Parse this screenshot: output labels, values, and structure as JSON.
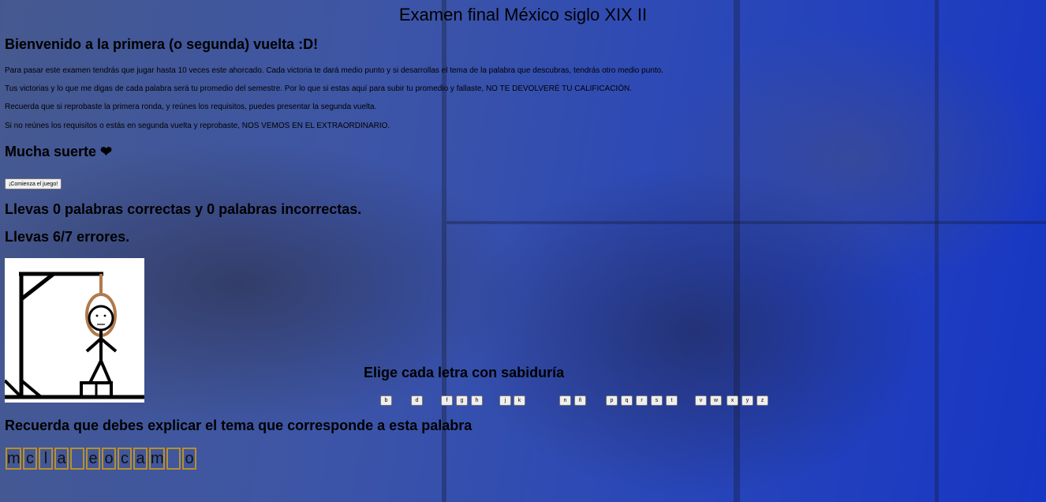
{
  "page": {
    "title": "Examen final México siglo XIX II",
    "welcome_heading": "Bienvenido a la primera (o segunda) vuelta :D!",
    "paragraphs": [
      "Para pasar este examen tendrás que jugar hasta 10 veces este ahorcado. Cada victoria te dará medio punto y si desarrollas el tema de la palabra que descubras, tendrás otro medio punto.",
      "Tus victorias y lo que me digas de cada palabra será tu promedio del semestre. Por lo que si estas aquí para subir tu promedio y fallaste, NO TE DEVOLVERÉ TU CALIFICACIÓN.",
      "Recuerda que si reprobaste la primera ronda, y reúnes los requisitos, puedes presentar la segunda vuelta.",
      "Si no reúnes los requisitos o estás en segunda vuelta y reprobaste, NOS VEMOS EN EL EXTRAORDINARIO."
    ],
    "luck_heading": "Mucha suerte ❤",
    "start_button": "¡Comienza el juego!",
    "score_text": "Llevas 0 palabras correctas y 0 palabras incorrectas.",
    "errors_text": "Llevas 6/7 errores.",
    "letters_heading": "Elige cada letra con sabiduría",
    "remember_heading": "Recuerda que debes explicar el tema que corresponde a esta palabra"
  },
  "hangman": {
    "errors": 6,
    "max_errors": 7
  },
  "letters": [
    "b",
    "d",
    "f",
    "g",
    "h",
    "j",
    "k",
    "n",
    "ñ",
    "p",
    "q",
    "r",
    "s",
    "t",
    "v",
    "w",
    "x",
    "y",
    "z"
  ],
  "word_tiles": [
    "m",
    "c",
    "l",
    "a",
    "",
    "e",
    "o",
    "c",
    "a",
    "m",
    "",
    "o"
  ],
  "colors": {
    "tile_border": "#b8902b",
    "background_accent": "#1636c4"
  }
}
